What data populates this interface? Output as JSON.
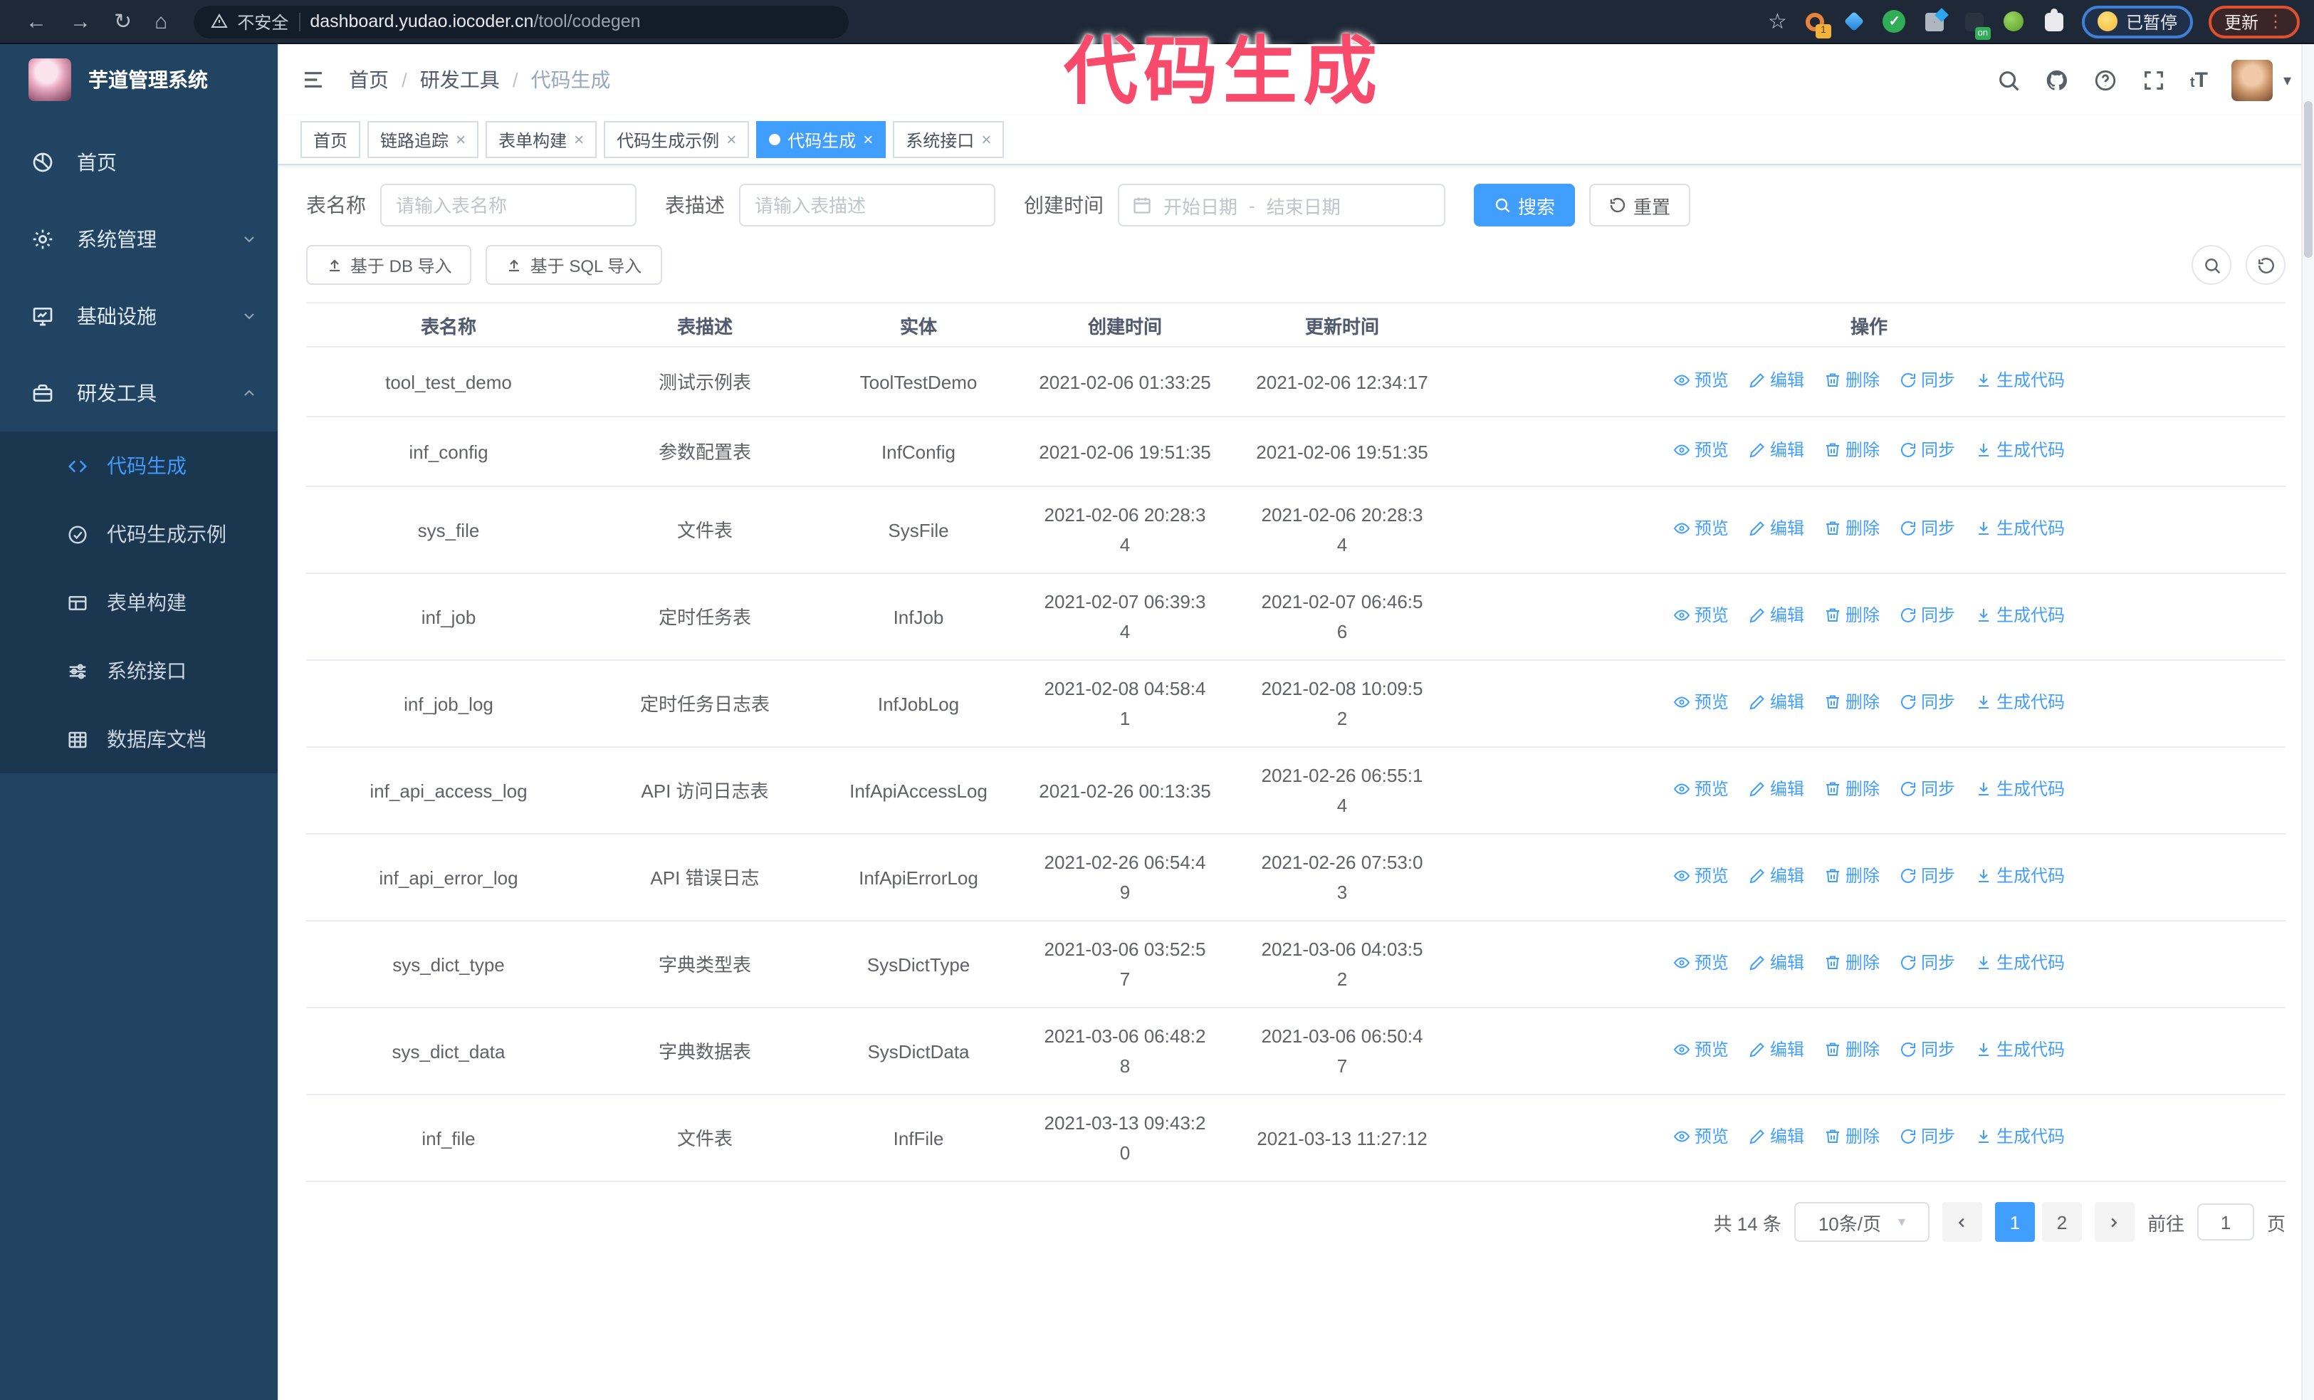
{
  "browser": {
    "security_label": "不安全",
    "url_host": "dashboard.yudao.iocoder.cn",
    "url_path": "/tool/codegen",
    "ext_badge_1": "1",
    "ext_badge_on": "on",
    "paused_badge": "已暂停",
    "update_button": "更新"
  },
  "annotation": {
    "text": "代码生成",
    "color": "#f84a6a"
  },
  "sidebar": {
    "title": "芋道管理系统",
    "items": [
      {
        "key": "home",
        "label": "首页",
        "icon": "dashboard-icon",
        "chevron": null
      },
      {
        "key": "system",
        "label": "系统管理",
        "icon": "gear-icon",
        "chevron": "down"
      },
      {
        "key": "infra",
        "label": "基础设施",
        "icon": "monitor-icon",
        "chevron": "down"
      },
      {
        "key": "devtools",
        "label": "研发工具",
        "icon": "toolbox-icon",
        "chevron": "up"
      }
    ],
    "subitems": [
      {
        "key": "codegen",
        "label": "代码生成",
        "icon": "code-icon",
        "active": true
      },
      {
        "key": "codegen-example",
        "label": "代码生成示例",
        "icon": "check-circle-icon",
        "active": false
      },
      {
        "key": "form-builder",
        "label": "表单构建",
        "icon": "form-icon",
        "active": false
      },
      {
        "key": "system-api",
        "label": "系统接口",
        "icon": "sliders-icon",
        "active": false
      },
      {
        "key": "db-doc",
        "label": "数据库文档",
        "icon": "table-grid-icon",
        "active": false
      }
    ]
  },
  "header": {
    "breadcrumb": [
      "首页",
      "研发工具",
      "代码生成"
    ]
  },
  "tabs": [
    {
      "label": "首页",
      "closable": false,
      "active": false
    },
    {
      "label": "链路追踪",
      "closable": true,
      "active": false
    },
    {
      "label": "表单构建",
      "closable": true,
      "active": false
    },
    {
      "label": "代码生成示例",
      "closable": true,
      "active": false
    },
    {
      "label": "代码生成",
      "closable": true,
      "active": true
    },
    {
      "label": "系统接口",
      "closable": true,
      "active": false
    }
  ],
  "search": {
    "name_label": "表名称",
    "name_placeholder": "请输入表名称",
    "desc_label": "表描述",
    "desc_placeholder": "请输入表描述",
    "time_label": "创建时间",
    "start_placeholder": "开始日期",
    "range_separator": "-",
    "end_placeholder": "结束日期",
    "search_button": "搜索",
    "reset_button": "重置"
  },
  "toolbar": {
    "import_db_label": "基于 DB 导入",
    "import_sql_label": "基于 SQL 导入"
  },
  "table": {
    "columns": [
      "表名称",
      "表描述",
      "实体",
      "创建时间",
      "更新时间",
      "操作"
    ],
    "actions": [
      {
        "label": "预览",
        "icon": "eye-icon"
      },
      {
        "label": "编辑",
        "icon": "edit-icon"
      },
      {
        "label": "删除",
        "icon": "delete-icon"
      },
      {
        "label": "同步",
        "icon": "sync-icon"
      },
      {
        "label": "生成代码",
        "icon": "download-icon"
      }
    ],
    "rows": [
      {
        "name": "tool_test_demo",
        "desc": "测试示例表",
        "entity": "ToolTestDemo",
        "created": "2021-02-06 01:33:25",
        "updated": "2021-02-06 12:34:17"
      },
      {
        "name": "inf_config",
        "desc": "参数配置表",
        "entity": "InfConfig",
        "created": "2021-02-06 19:51:35",
        "updated": "2021-02-06 19:51:35"
      },
      {
        "name": "sys_file",
        "desc": "文件表",
        "entity": "SysFile",
        "created": "2021-02-06 20:28:3\n4",
        "updated": "2021-02-06 20:28:3\n4"
      },
      {
        "name": "inf_job",
        "desc": "定时任务表",
        "entity": "InfJob",
        "created": "2021-02-07 06:39:3\n4",
        "updated": "2021-02-07 06:46:5\n6"
      },
      {
        "name": "inf_job_log",
        "desc": "定时任务日志表",
        "entity": "InfJobLog",
        "created": "2021-02-08 04:58:4\n1",
        "updated": "2021-02-08 10:09:5\n2"
      },
      {
        "name": "inf_api_access_log",
        "desc": "API 访问日志表",
        "entity": "InfApiAccessLog",
        "created": "2021-02-26 00:13:35",
        "updated": "2021-02-26 06:55:1\n4"
      },
      {
        "name": "inf_api_error_log",
        "desc": "API 错误日志",
        "entity": "InfApiErrorLog",
        "created": "2021-02-26 06:54:4\n9",
        "updated": "2021-02-26 07:53:0\n3"
      },
      {
        "name": "sys_dict_type",
        "desc": "字典类型表",
        "entity": "SysDictType",
        "created": "2021-03-06 03:52:5\n7",
        "updated": "2021-03-06 04:03:5\n2"
      },
      {
        "name": "sys_dict_data",
        "desc": "字典数据表",
        "entity": "SysDictData",
        "created": "2021-03-06 06:48:2\n8",
        "updated": "2021-03-06 06:50:4\n7"
      },
      {
        "name": "inf_file",
        "desc": "文件表",
        "entity": "InfFile",
        "created": "2021-03-13 09:43:2\n0",
        "updated": "2021-03-13 11:27:12"
      }
    ]
  },
  "pagination": {
    "total_label": "共 14 条",
    "page_size_label": "10条/页",
    "pages": [
      "1",
      "2"
    ],
    "active_page": "1",
    "goto_label": "前往",
    "goto_value": "1",
    "goto_suffix": "页"
  },
  "colors": {
    "accent": "#409eff",
    "sidebar_bg": "#204461",
    "submenu_bg": "#1b364f",
    "annotation": "#f84a6a",
    "browser_bar": "#1e2836"
  }
}
